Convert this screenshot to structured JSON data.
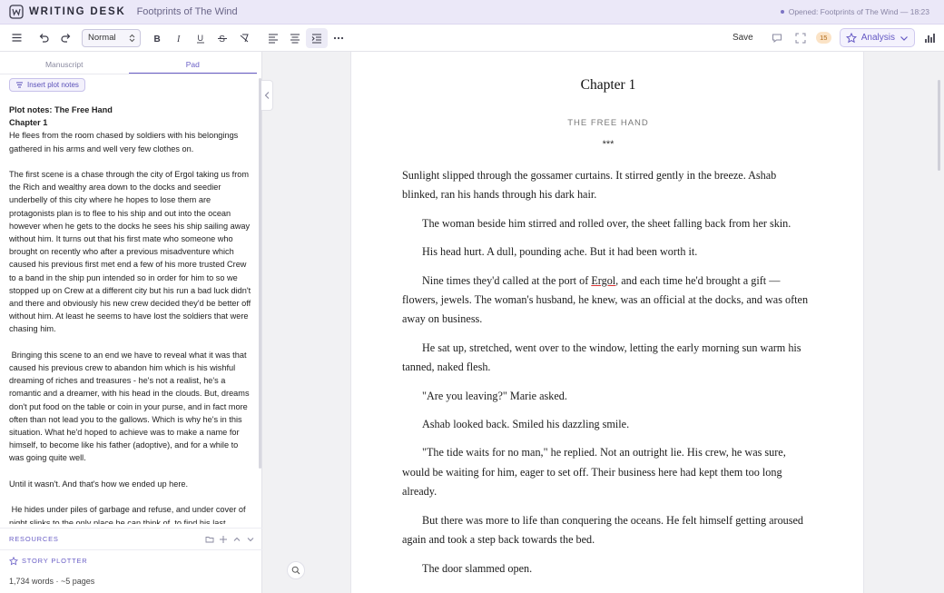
{
  "app": {
    "name": "WRITING DESK",
    "document_title": "Footprints of The Wind",
    "opened_status": "Opened: Footprints of The Wind — 18:23"
  },
  "toolbar": {
    "style_value": "Normal",
    "save_label": "Save",
    "comments_badge": "15",
    "analysis_label": "Analysis"
  },
  "left_panel": {
    "tabs": [
      {
        "label": "Manuscript"
      },
      {
        "label": "Pad"
      }
    ],
    "insert_button": "Insert plot notes",
    "pad": {
      "title": "Plot notes: The Free Hand",
      "chapter": "Chapter 1",
      "paragraphs": [
        "He flees from the room chased by soldiers with his belongings gathered in his arms and well very few clothes on.",
        "The first scene is a chase through the city of Ergol taking us from the Rich and wealthy area down to the docks and seedier underbelly of this city where he hopes to lose them are protagonists plan is to flee to his ship and out into the ocean however when he gets to the docks he sees his ship sailing away without him. It turns out that his first mate who someone who brought on recently who after a previous misadventure which caused his previous first met end a few of his more trusted Crew to a band in the ship pun intended so in order for him to so we stopped up on Crew at a different city but his run a bad luck didn't and there and obviously his new crew decided they'd be better off without him. At least he seems to have lost the soldiers that were chasing him.",
        " Bringing this scene to an end we have to reveal what it was that caused his previous crew to abandon him which is his wishful dreaming of riches and treasures - he's not a realist, he's a romantic and a dreamer, with his head in the clouds. But, dreams don't put food on the table or coin in your purse, and in fact more often than not lead you to the gallows. Which is why he's in this situation. What he'd hoped to achieve was to make a name for himself, to become like his father (adoptive), and for a while to was going quite well.",
        "Until it wasn't. And that's how we ended up here.",
        " He hides under piles of garbage and refuse, and under cover of night slinks to the only place he can think of, to find his last"
      ]
    },
    "resources_label": "RESOURCES",
    "plotter_label": "STORY PLOTTER",
    "word_count": "1,734 words · ~5 pages"
  },
  "editor": {
    "chapter_title": "Chapter 1",
    "chapter_subtitle": "THE FREE HAND",
    "separator": "***",
    "paragraphs": [
      "Sunlight slipped through the gossamer curtains. It stirred gently in the breeze. Ashab blinked, ran his hands through his dark hair.",
      "The woman beside him stirred and rolled over, the sheet falling back from her skin.",
      "His head hurt. A dull, pounding ache. But it had been worth it.",
      {
        "before": "Nine times they'd called at the port of ",
        "marked": "Ergol",
        "after": ", and each time he'd brought a gift — flowers, jewels. The woman's husband, he knew, was an official at the docks, and was often away on business."
      },
      "He sat up, stretched, went over to the window, letting the early morning sun warm his tanned, naked flesh.",
      "\"Are you leaving?\" Marie asked.",
      "Ashab looked back. Smiled his dazzling smile.",
      "\"The tide waits for no man,\" he replied. Not an outright lie. His crew, he was sure, would be waiting for him, eager to set off. Their business here had kept them too long already.",
      "But there was more to life than conquering the oceans. He felt himself getting aroused again and took a step back towards the bed.",
      "The door slammed open."
    ]
  },
  "colors": {
    "accent": "#6a5fc6",
    "topbar_bg": "#ebe8f8",
    "badge_bg": "#fbe3c6"
  }
}
